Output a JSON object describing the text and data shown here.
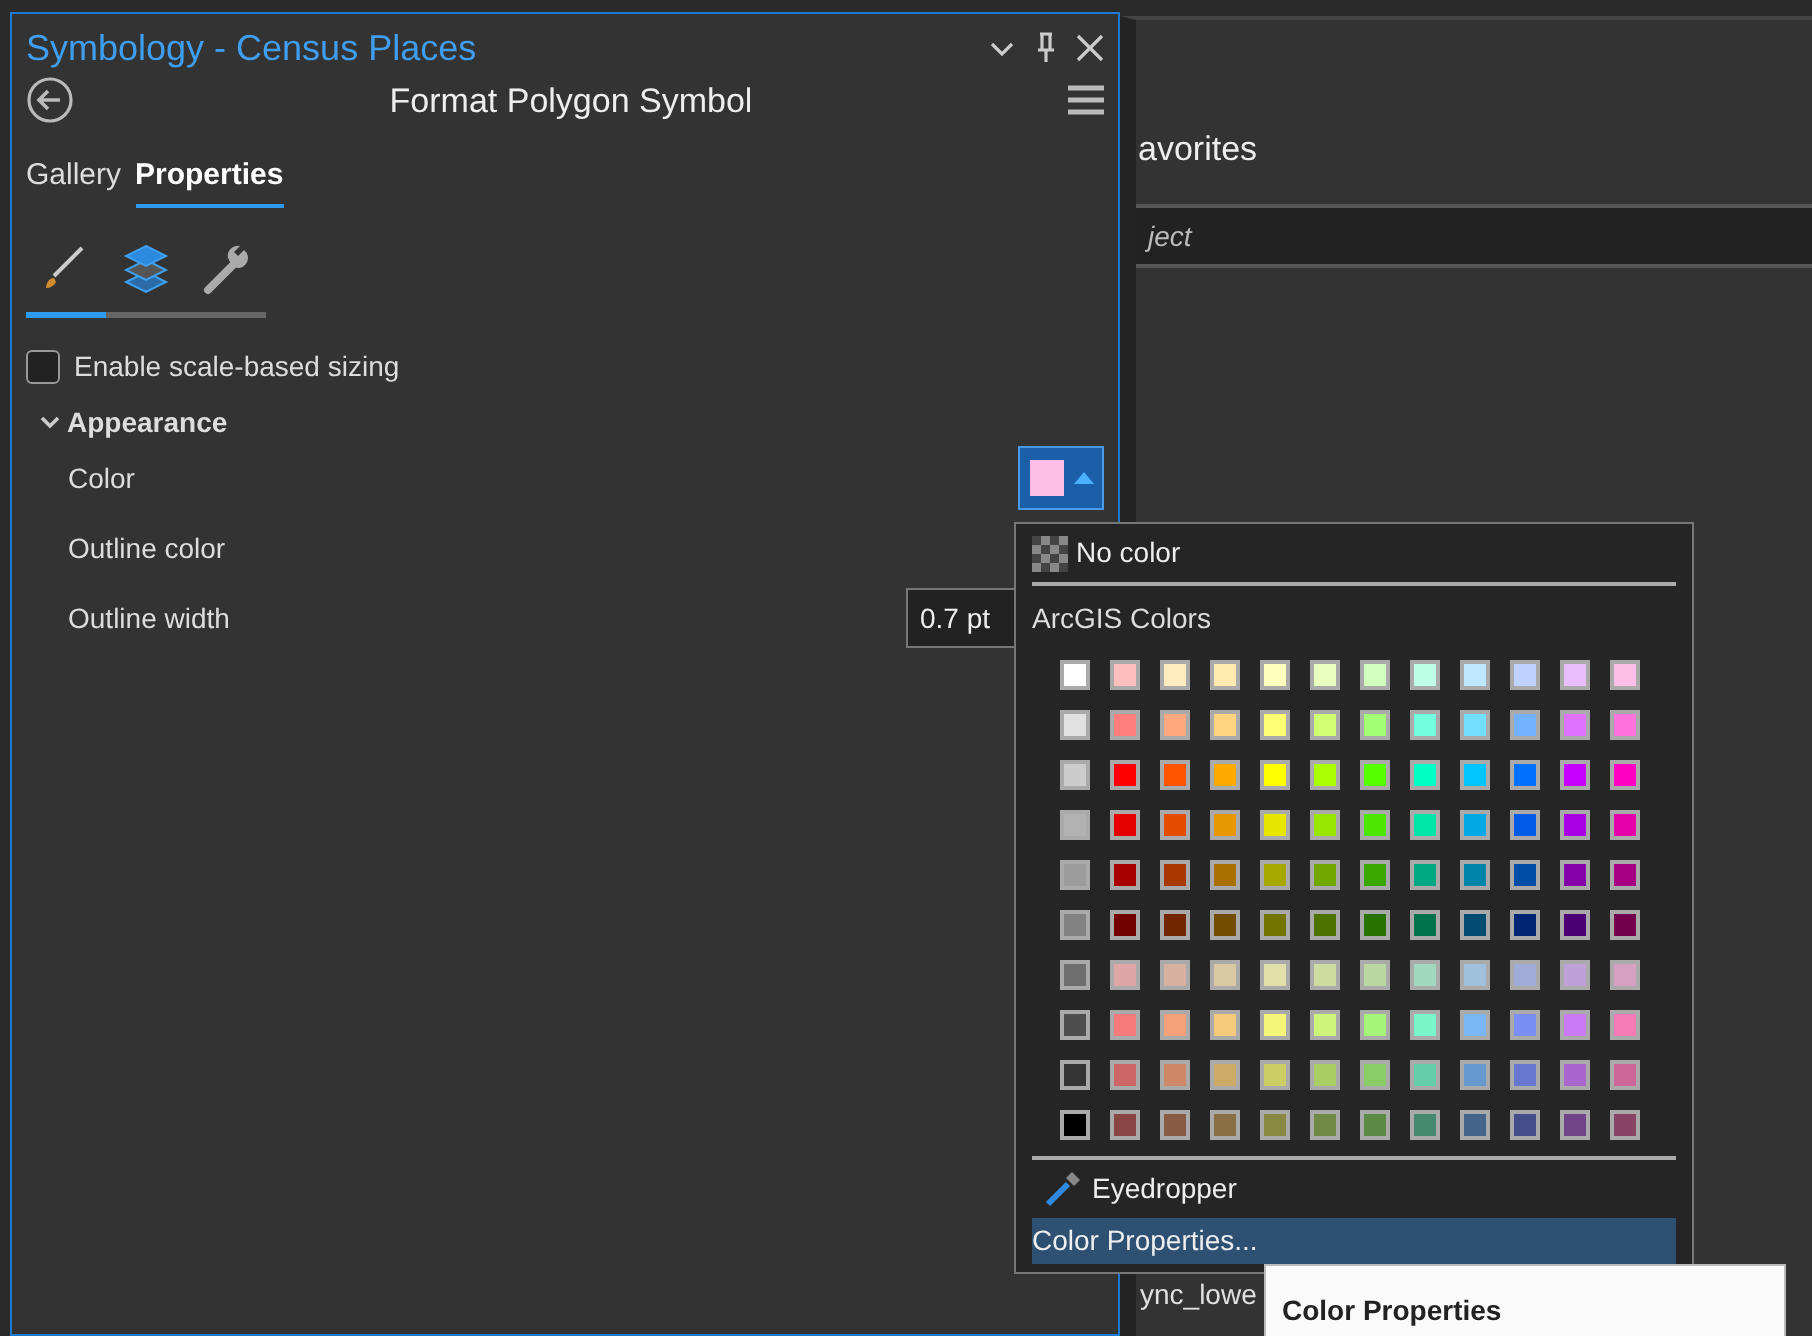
{
  "pane": {
    "title": "Symbology - Census Places",
    "heading": "Format Polygon Symbol"
  },
  "tabs": [
    {
      "label": "Gallery",
      "selected": false
    },
    {
      "label": "Properties",
      "selected": true
    }
  ],
  "icon_tabs": [
    {
      "kind": "brush",
      "selected": true
    },
    {
      "kind": "layers",
      "selected": false
    },
    {
      "kind": "wrench",
      "selected": false
    }
  ],
  "scale_sizing": {
    "label": "Enable scale-based sizing",
    "checked": false
  },
  "appearance": {
    "label": "Appearance",
    "expanded": true,
    "rows": [
      {
        "kind": "color",
        "label": "Color",
        "color": "#ffbee8"
      },
      {
        "kind": "plain",
        "label": "Outline color"
      },
      {
        "kind": "number",
        "label": "Outline width",
        "value": "0.7 pt"
      }
    ]
  },
  "color_menu": {
    "no_color": "No color",
    "section": "ArcGIS Colors",
    "swatches": [
      [
        {
          "color": "#ffffff"
        },
        {
          "color": "#ffbebe"
        },
        {
          "color": "#ffebbe"
        },
        {
          "color": "#ffebaf"
        },
        {
          "color": "#ffffbe"
        },
        {
          "color": "#e9ffbe"
        },
        {
          "color": "#d3ffbe"
        },
        {
          "color": "#beffe8"
        },
        {
          "color": "#bee8ff"
        },
        {
          "color": "#bed2ff"
        },
        {
          "color": "#e8beff"
        },
        {
          "color": "#ffbee8"
        }
      ],
      [
        {
          "color": "#e1e1e1"
        },
        {
          "color": "#ff7f7f"
        },
        {
          "color": "#ffa77f"
        },
        {
          "color": "#ffd37f"
        },
        {
          "color": "#ffff73"
        },
        {
          "color": "#d1ff73"
        },
        {
          "color": "#a3ff73"
        },
        {
          "color": "#73ffdf"
        },
        {
          "color": "#73dfff"
        },
        {
          "color": "#73b2ff"
        },
        {
          "color": "#df73ff"
        },
        {
          "color": "#ff73df"
        }
      ],
      [
        {
          "color": "#cccccc"
        },
        {
          "color": "#ff0000"
        },
        {
          "color": "#ff5500"
        },
        {
          "color": "#ffaa00"
        },
        {
          "color": "#ffff00"
        },
        {
          "color": "#aaff00"
        },
        {
          "color": "#55ff00"
        },
        {
          "color": "#00ffc5"
        },
        {
          "color": "#00c5ff"
        },
        {
          "color": "#0070ff"
        },
        {
          "color": "#c500ff"
        },
        {
          "color": "#ff00c5"
        }
      ],
      [
        {
          "color": "#b2b2b2"
        },
        {
          "color": "#e60000"
        },
        {
          "color": "#e64c00"
        },
        {
          "color": "#e69800"
        },
        {
          "color": "#e6e600"
        },
        {
          "color": "#98e600"
        },
        {
          "color": "#4ce600"
        },
        {
          "color": "#00e6a9"
        },
        {
          "color": "#00a9e6"
        },
        {
          "color": "#005ce6"
        },
        {
          "color": "#a900e6"
        },
        {
          "color": "#e600a9"
        }
      ],
      [
        {
          "color": "#9c9c9c"
        },
        {
          "color": "#a80000"
        },
        {
          "color": "#a83800"
        },
        {
          "color": "#a87000"
        },
        {
          "color": "#a8a800"
        },
        {
          "color": "#70a800"
        },
        {
          "color": "#38a800"
        },
        {
          "color": "#00a884"
        },
        {
          "color": "#0084a8"
        },
        {
          "color": "#004da8"
        },
        {
          "color": "#8400a8"
        },
        {
          "color": "#a80084"
        }
      ],
      [
        {
          "color": "#828282"
        },
        {
          "color": "#730000"
        },
        {
          "color": "#732600"
        },
        {
          "color": "#734c00"
        },
        {
          "color": "#737300"
        },
        {
          "color": "#4c7300"
        },
        {
          "color": "#267300"
        },
        {
          "color": "#00734c"
        },
        {
          "color": "#004c73"
        },
        {
          "color": "#002673"
        },
        {
          "color": "#4c0073"
        },
        {
          "color": "#73004c"
        }
      ],
      [
        {
          "color": "#6e6e6e"
        },
        {
          "color": "#e0a5a5"
        },
        {
          "color": "#d8b0a0"
        },
        {
          "color": "#dac8a0"
        },
        {
          "color": "#e0e0a8"
        },
        {
          "color": "#cfdca0"
        },
        {
          "color": "#b8d8a0"
        },
        {
          "color": "#a0d8c0"
        },
        {
          "color": "#a0c0dc"
        },
        {
          "color": "#a0acd8"
        },
        {
          "color": "#c0a0d8"
        },
        {
          "color": "#d8a0c0"
        }
      ],
      [
        {
          "color": "#4e4e4e"
        },
        {
          "color": "#f57a7a"
        },
        {
          "color": "#f5a27a"
        },
        {
          "color": "#f5ca7a"
        },
        {
          "color": "#f5f57a"
        },
        {
          "color": "#cdf57a"
        },
        {
          "color": "#a5f57a"
        },
        {
          "color": "#7af5ca"
        },
        {
          "color": "#7ab6f5"
        },
        {
          "color": "#7a8ef5"
        },
        {
          "color": "#ca7af5"
        },
        {
          "color": "#f57ab6"
        }
      ],
      [
        {
          "color": "#343434"
        },
        {
          "color": "#cd6666"
        },
        {
          "color": "#cd8966"
        },
        {
          "color": "#cdaa66"
        },
        {
          "color": "#cdcd66"
        },
        {
          "color": "#aacd66"
        },
        {
          "color": "#89cd66"
        },
        {
          "color": "#66cdab"
        },
        {
          "color": "#6699cd"
        },
        {
          "color": "#6677cd"
        },
        {
          "color": "#aa66cd"
        },
        {
          "color": "#cd6699"
        }
      ],
      [
        {
          "color": "#000000"
        },
        {
          "color": "#894444"
        },
        {
          "color": "#895a44"
        },
        {
          "color": "#897044"
        },
        {
          "color": "#898944"
        },
        {
          "color": "#708944"
        },
        {
          "color": "#5c8944"
        },
        {
          "color": "#448970"
        },
        {
          "color": "#446589"
        },
        {
          "color": "#444f89"
        },
        {
          "color": "#704489"
        },
        {
          "color": "#894465"
        }
      ]
    ],
    "eyedropper": "Eyedropper",
    "properties": {
      "label": "Color Properties...",
      "highlighted": true
    }
  },
  "tooltip": "Color Properties",
  "background_pane": {
    "heading": "avorites",
    "search_placeholder": "ject",
    "item": "ync_lowe"
  }
}
